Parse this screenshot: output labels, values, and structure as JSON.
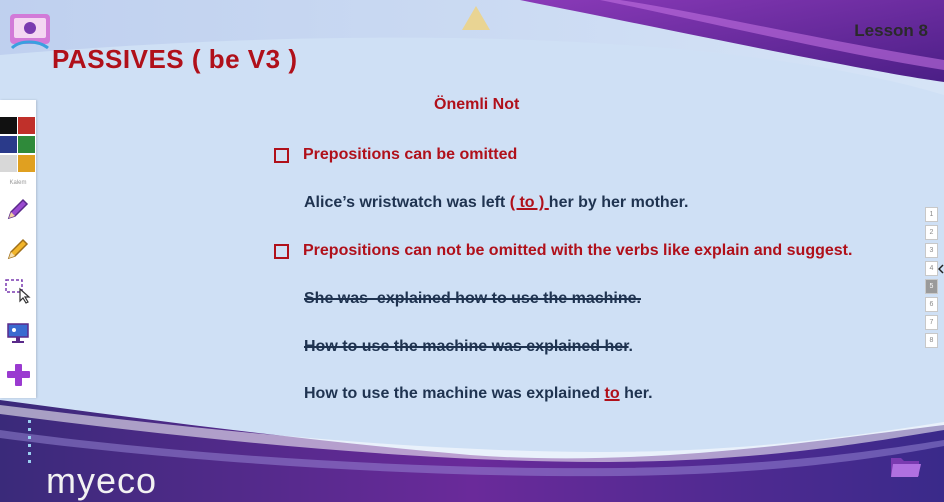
{
  "slide": {
    "title": "PASSIVES ( be V3 )",
    "lesson": "Lesson 8",
    "heading": "Önemli Not",
    "brand": "myeco",
    "watermark": "myeco"
  },
  "content": {
    "bullet1": "Prepositions can be omitted",
    "example1": {
      "before": "Alice’s wristwatch was left ",
      "highlight": "( to ) ",
      "after": "her by her mother."
    },
    "bullet2": "Prepositions can not be omitted with the verbs like explain and suggest.",
    "wrong1": "She was  explained how to use the machine.",
    "wrong2": {
      "struck": "How to use the machine was explained her",
      "tail": "."
    },
    "correct": {
      "before": "How to use the machine was explained ",
      "highlight": "to",
      "after": " her."
    }
  },
  "toolbar": {
    "size_label": "Kalem",
    "colors": [
      "#111111",
      "#c0302a",
      "#2a3a8a",
      "#2f8a3a",
      "#d8d8d8",
      "#e0a020"
    ],
    "tools": [
      "pen-icon",
      "highlighter-icon",
      "select-icon",
      "presentation-icon",
      "add-icon"
    ]
  },
  "pages": [
    "1",
    "2",
    "3",
    "4",
    "5",
    "6",
    "7",
    "8"
  ],
  "active_page": "5",
  "colors": {
    "title_red": "#b0101a",
    "text_navy": "#1f3350",
    "background": "#cfe0f5",
    "purple": "#6a2a9a"
  }
}
